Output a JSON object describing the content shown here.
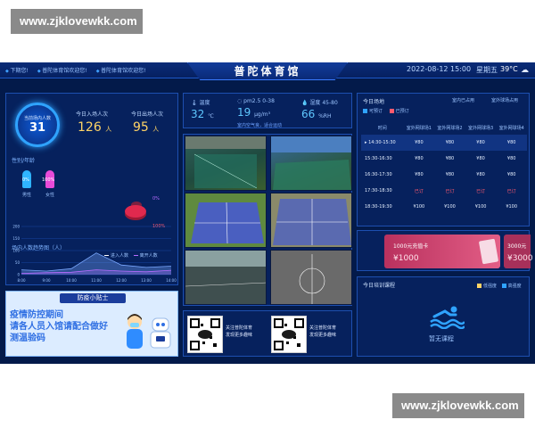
{
  "watermark_top": "www.zjklovewkk.com",
  "watermark_bottom": "www.zjklovewkk.com",
  "header": {
    "ticker": [
      "下期您!",
      "普陀体育馆欢迎您!",
      "普陀体育馆欢迎您!"
    ],
    "title": "普陀体育馆",
    "datetime": "2022-08-12 15:00",
    "weekday": "星期五",
    "temperature": "39°C",
    "weather_icon": "cloud-sun-icon"
  },
  "left": {
    "in_venue_label": "当前场内人数",
    "in_venue_count": "31",
    "today_in_label": "今日入场人次",
    "today_in": "126",
    "today_out_label": "今日出场人次",
    "today_out": "95",
    "unit": "人",
    "gender_title": "性别/年龄",
    "male_pct": "0%",
    "male_label": "男性",
    "female_pct": "100%",
    "female_label": "女性",
    "age_a": "0%",
    "age_b": "100%",
    "trend_title": "场内人数趋势图（人）",
    "legend_in": "进入人数",
    "legend_out": "离开人数"
  },
  "chart_data": {
    "type": "area",
    "title": "场内人数趋势图（人）",
    "x": [
      "8:00",
      "9:00",
      "10:00",
      "11:00",
      "12:00",
      "13:00",
      "14:00"
    ],
    "ylim": [
      0,
      200
    ],
    "yticks": [
      0,
      50,
      100,
      150,
      200
    ],
    "series": [
      {
        "name": "进入人数",
        "values": [
          20,
          15,
          25,
          90,
          40,
          30,
          35
        ]
      },
      {
        "name": "离开人数",
        "values": [
          5,
          8,
          10,
          20,
          15,
          12,
          18
        ]
      }
    ]
  },
  "tips": {
    "header": "防疫小贴士",
    "line1": "疫情防控期间",
    "line2": "请各人员入馆请配合做好",
    "line3": "测温验码"
  },
  "env": {
    "temp_label": "温度",
    "temp_value": "32",
    "temp_unit": "℃",
    "pm_label": "pm2.5",
    "pm_range": "0-38",
    "pm_value": "19",
    "pm_unit": "μg/m³",
    "humidity_label": "湿度",
    "humidity_range": "45-80",
    "humidity_value": "66",
    "humidity_unit": "%RH",
    "note": "室内空气良，适合运动"
  },
  "qr": [
    {
      "text1": "关注普陀体育",
      "text2": "发现更多趣味"
    },
    {
      "text1": "关注普陀体育",
      "text2": "发现更多趣味"
    }
  ],
  "booking": {
    "title": "今日场地",
    "opt_left": "室内已占用",
    "opt_right": "室外球场占用",
    "legend_available": "可预订",
    "legend_booked": "已预订",
    "columns": [
      "时间",
      "室外网球场1",
      "室外网球场2",
      "室外网球场3",
      "室外网球场4"
    ],
    "rows": [
      {
        "time": "14:30-15:30",
        "cells": [
          "¥80",
          "¥80",
          "¥80",
          "¥80"
        ],
        "active": true
      },
      {
        "time": "15:30-16:30",
        "cells": [
          "¥80",
          "¥80",
          "¥80",
          "¥80"
        ],
        "active": false
      },
      {
        "time": "16:30-17:30",
        "cells": [
          "¥80",
          "¥80",
          "¥80",
          "¥80"
        ],
        "active": false
      },
      {
        "time": "17:30-18:30",
        "cells": [
          "已订",
          "已订",
          "已订",
          "已订"
        ],
        "active": false
      },
      {
        "time": "18:30-19:30",
        "cells": [
          "¥100",
          "¥100",
          "¥100",
          "¥100"
        ],
        "active": false
      }
    ]
  },
  "promo": {
    "card1_title": "1000元充值卡",
    "card1_price": "¥1000",
    "card2_title": "3000元",
    "card2_price": "¥3000"
  },
  "course": {
    "title": "今日培训课程",
    "legend_a": "低强度",
    "legend_b": "高强度",
    "empty": "暂无课程"
  },
  "colors": {
    "bg": "#031a4a",
    "accent": "#2fa3ff",
    "gold": "#ffd466",
    "alert": "#ff5a6e"
  }
}
